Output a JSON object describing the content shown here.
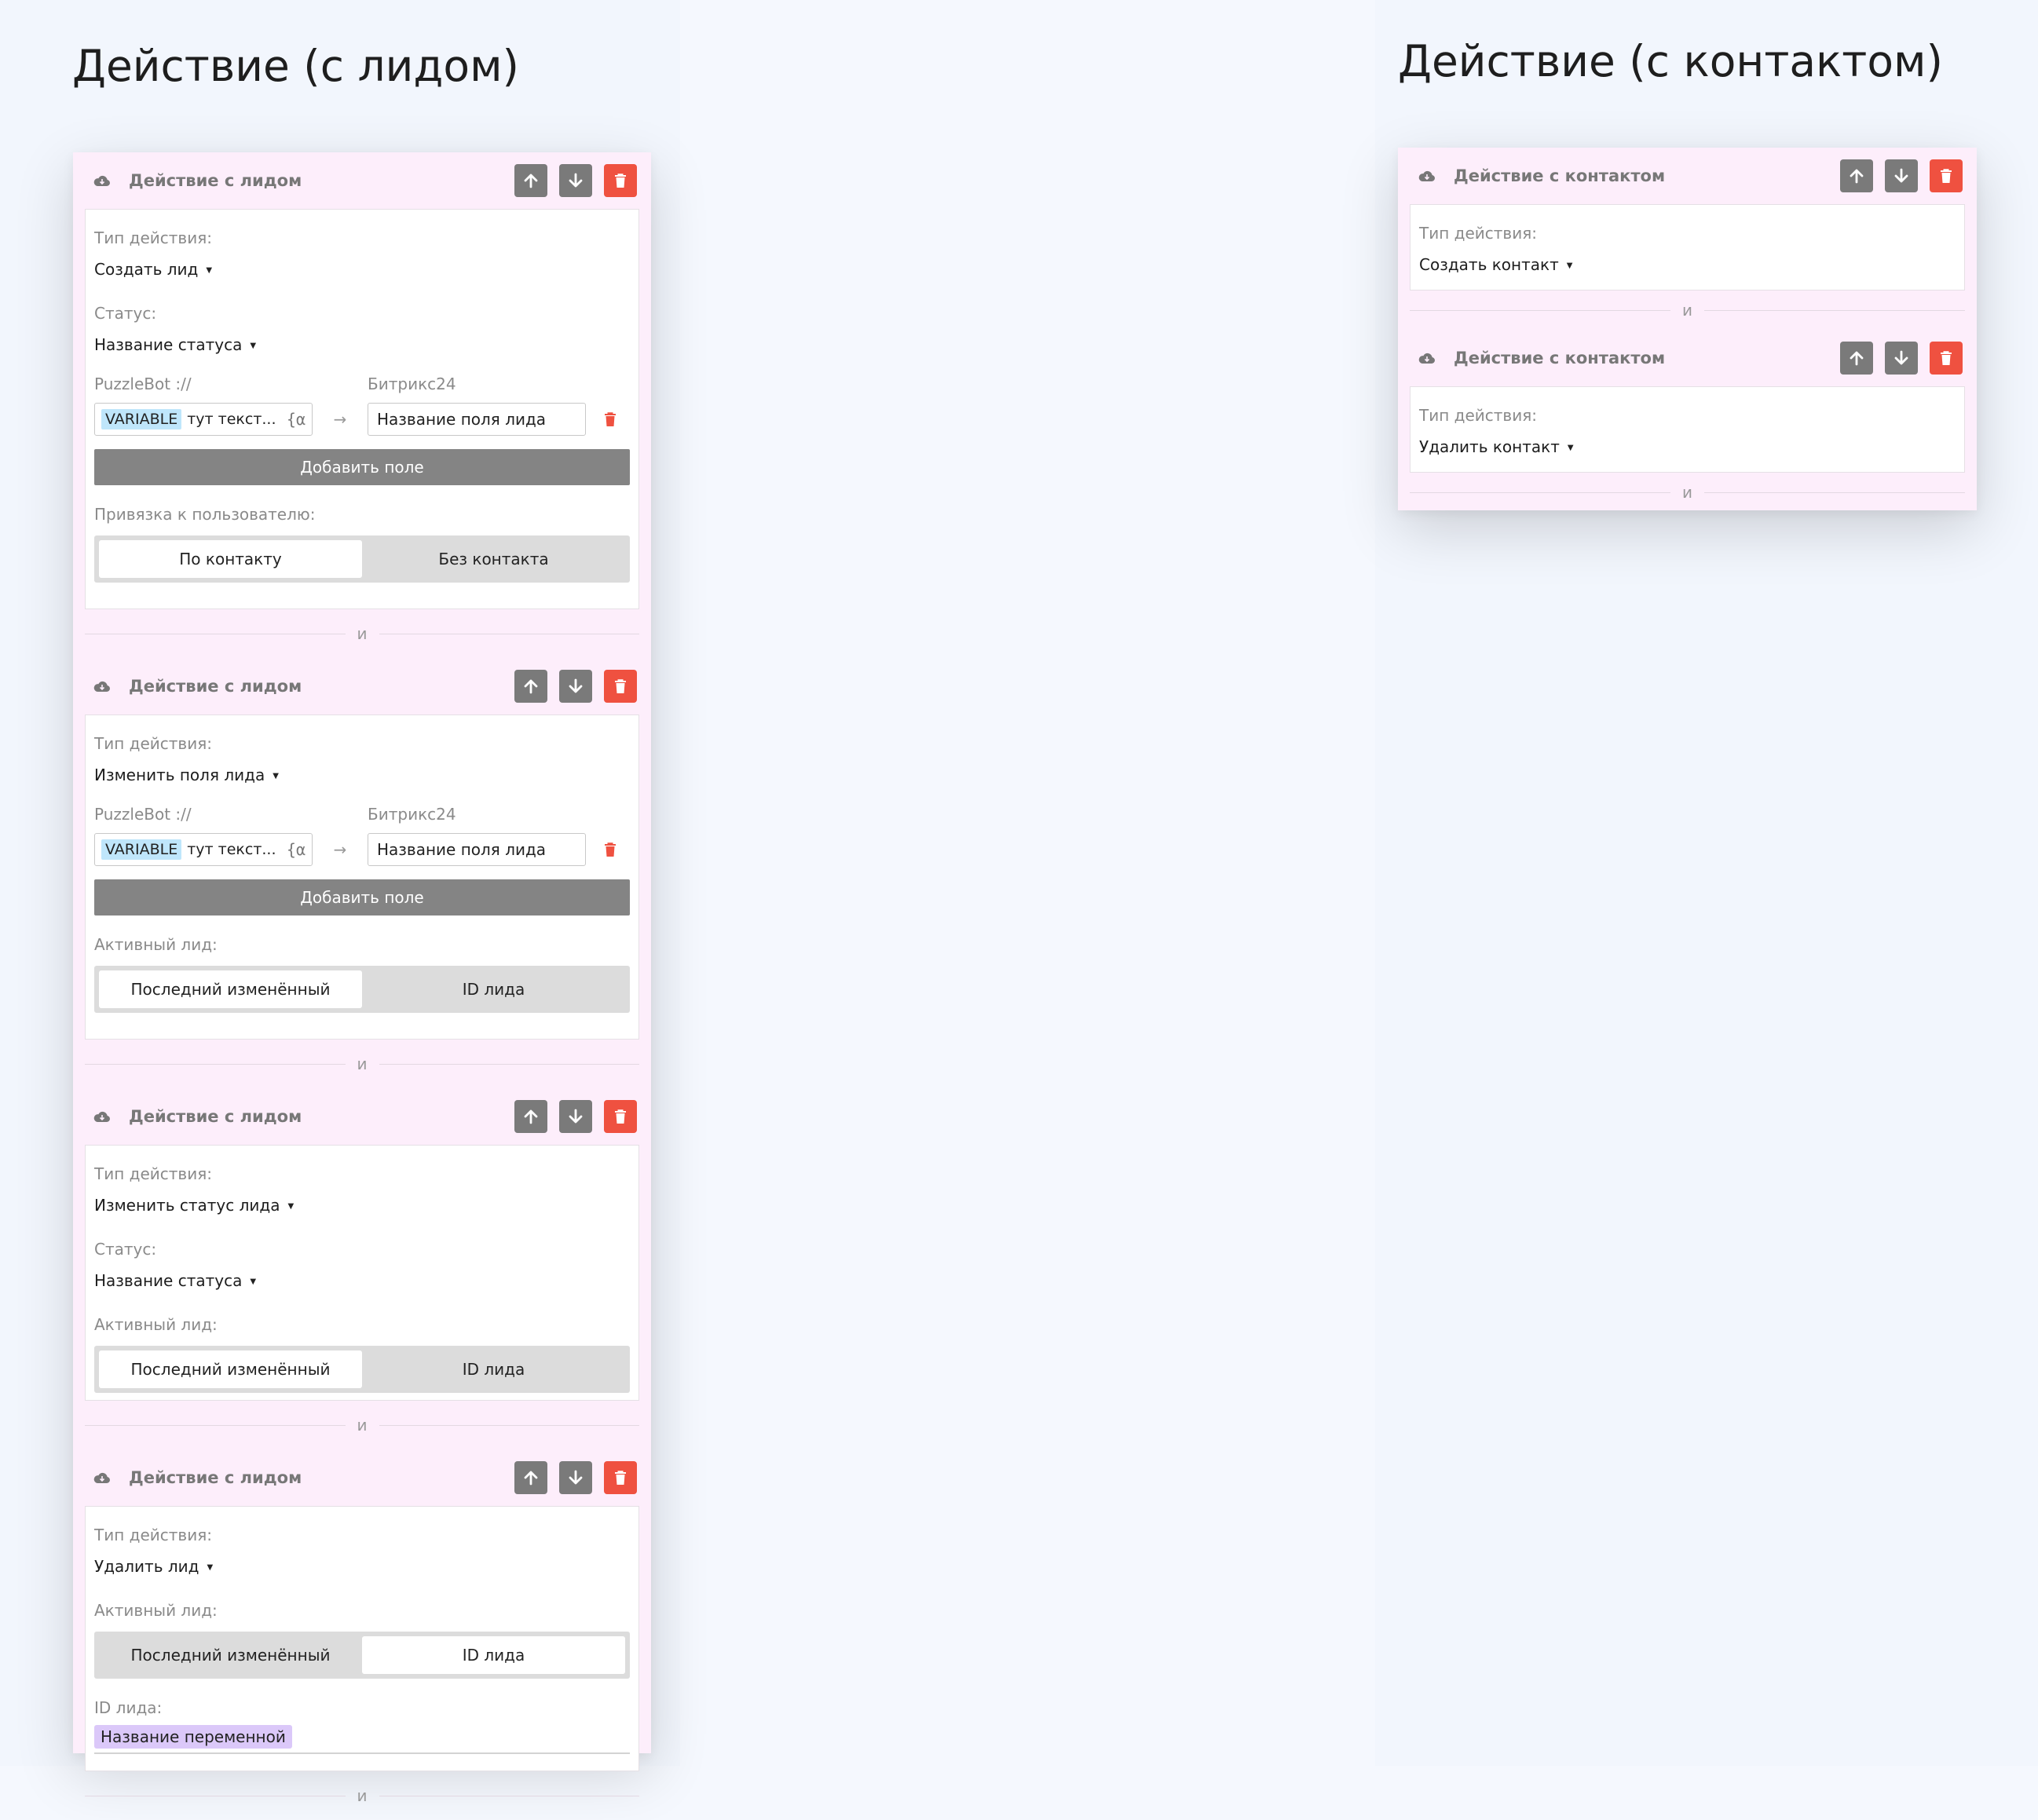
{
  "left": {
    "section_title": "Действие (с лидом)",
    "blocks": [
      {
        "title": "Действие с лидом",
        "action_type_label": "Тип действия:",
        "action_type_value": "Создать лид",
        "status_label": "Статус:",
        "status_value": "Название статуса",
        "mapping": {
          "source_label": "PuzzleBot ://",
          "target_label": "Битрикс24",
          "variable_chip": "VARIABLE",
          "variable_text": "тут текст...",
          "brace": "{α",
          "arrow": "→",
          "field_value": "Название поля лида"
        },
        "add_field": "Добавить поле",
        "binding_label": "Привязка к пользователю:",
        "binding_options": [
          "По контакту",
          "Без контакта"
        ],
        "binding_selected": "По контакту"
      },
      {
        "title": "Действие с лидом",
        "action_type_label": "Тип действия:",
        "action_type_value": "Изменить поля лида",
        "mapping": {
          "source_label": "PuzzleBot ://",
          "target_label": "Битрикс24",
          "variable_chip": "VARIABLE",
          "variable_text": "тут текст...",
          "brace": "{α",
          "arrow": "→",
          "field_value": "Название поля лида"
        },
        "add_field": "Добавить поле",
        "active_lead_label": "Активный лид:",
        "active_lead_options": [
          "Последний изменённый",
          "ID лида"
        ],
        "active_lead_selected": "Последний изменённый"
      },
      {
        "title": "Действие с лидом",
        "action_type_label": "Тип действия:",
        "action_type_value": "Изменить статус лида",
        "status_label": "Статус:",
        "status_value": "Название статуса",
        "active_lead_label": "Активный лид:",
        "active_lead_options": [
          "Последний изменённый",
          "ID лида"
        ],
        "active_lead_selected": "Последний изменённый"
      },
      {
        "title": "Действие с лидом",
        "action_type_label": "Тип действия:",
        "action_type_value": "Удалить лид",
        "active_lead_label": "Активный лид:",
        "active_lead_options": [
          "Последний изменённый",
          "ID лида"
        ],
        "active_lead_selected": "ID лида",
        "lead_id_label": "ID лида:",
        "lead_id_variable": "Название переменной"
      }
    ],
    "and_label": "и"
  },
  "right": {
    "section_title": "Действие (с контактом)",
    "blocks": [
      {
        "title": "Действие с контактом",
        "action_type_label": "Тип действия:",
        "action_type_value": "Создать контакт"
      },
      {
        "title": "Действие с контактом",
        "action_type_label": "Тип действия:",
        "action_type_value": "Удалить контакт"
      }
    ],
    "and_label": "и"
  },
  "icons": {
    "header": "cloud-icon",
    "move_up": "arrow-up-icon",
    "move_down": "arrow-down-icon",
    "delete": "trash-icon",
    "caret": "caret-down-icon"
  },
  "colors": {
    "panel_bg": "#fdeefb",
    "gray_button": "#7a7a7a",
    "delete_button": "#ef5140",
    "variable_chip": "#bfe6fb",
    "variable_name_chip": "#dbc8f9",
    "add_field_button": "#848484"
  }
}
